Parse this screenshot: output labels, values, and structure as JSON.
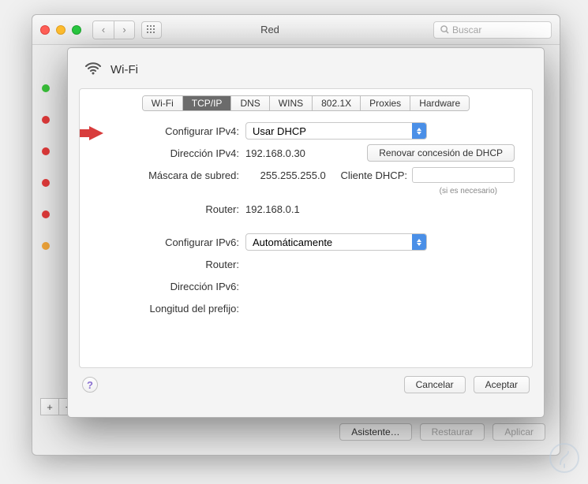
{
  "parent": {
    "title": "Red",
    "search_placeholder": "Buscar",
    "add_label": "+",
    "minus_label": "−",
    "gear_label": "⚙",
    "btn_asistente": "Asistente…",
    "btn_restaurar": "Restaurar",
    "btn_aplicar": "Aplicar"
  },
  "sheet": {
    "title": "Wi-Fi",
    "tabs": {
      "wifi": "Wi-Fi",
      "tcpip": "TCP/IP",
      "dns": "DNS",
      "wins": "WINS",
      "8021x": "802.1X",
      "proxies": "Proxies",
      "hardware": "Hardware"
    },
    "labels": {
      "config_ipv4": "Configurar IPv4:",
      "dir_ipv4": "Dirección IPv4:",
      "mascara": "Máscara de subred:",
      "router4": "Router:",
      "config_ipv6": "Configurar IPv6:",
      "router6": "Router:",
      "dir_ipv6": "Dirección IPv6:",
      "prefijo": "Longitud del prefijo:",
      "dhcp_client": "Cliente DHCP:",
      "necessary": "(si es necesario)"
    },
    "values": {
      "config_ipv4": "Usar DHCP",
      "dir_ipv4": "192.168.0.30",
      "mascara": "255.255.255.0",
      "router4": "192.168.0.1",
      "config_ipv6": "Automáticamente",
      "router6": "",
      "dir_ipv6": "",
      "prefijo": ""
    },
    "buttons": {
      "renew": "Renovar concesión de DHCP",
      "cancel": "Cancelar",
      "ok": "Aceptar",
      "help": "?"
    }
  }
}
